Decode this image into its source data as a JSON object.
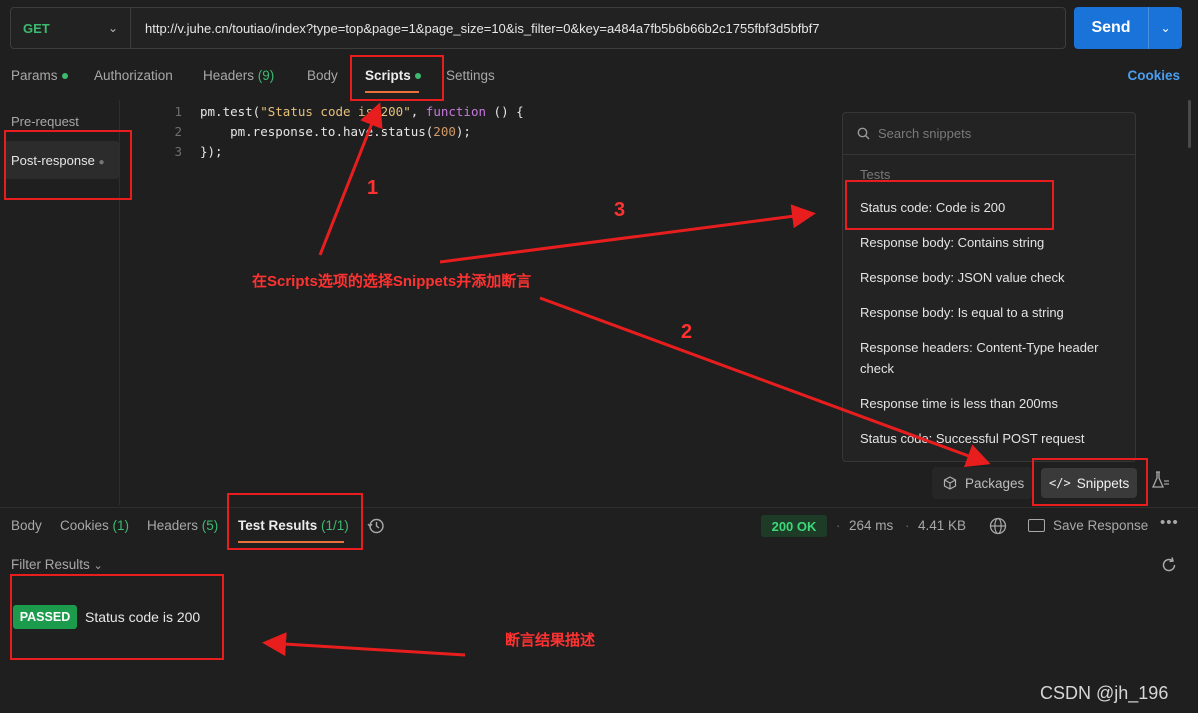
{
  "request": {
    "method": "GET",
    "url": "http://v.juhe.cn/toutiao/index?type=top&page=1&page_size=10&is_filter=0&key=a484a7fb5b6b66b2c1755fbf3d5bfbf7",
    "send_label": "Send"
  },
  "tabs": {
    "params": "Params",
    "authorization": "Authorization",
    "headers": "Headers",
    "headers_count": "(9)",
    "body": "Body",
    "scripts": "Scripts",
    "settings": "Settings",
    "cookies": "Cookies"
  },
  "scripts": {
    "pre_request": "Pre-request",
    "post_response": "Post-response",
    "code": {
      "line1_a": "pm.test(",
      "line1_str": "\"Status code is 200\"",
      "line1_b": ", ",
      "line1_kw": "function",
      "line1_c": " () {",
      "line2_a": "    pm.response.to.have.status(",
      "line2_num": "200",
      "line2_b": ");",
      "line3": "});"
    }
  },
  "snippets": {
    "search_placeholder": "Search snippets",
    "category": "Tests",
    "items": [
      "Status code: Code is 200",
      "Response body: Contains string",
      "Response body: JSON value check",
      "Response body: Is equal to a string",
      "Response headers: Content-Type header check",
      "Response time is less than 200ms",
      "Status code: Successful POST request"
    ],
    "packages_label": "Packages",
    "snippets_label": "Snippets",
    "snippets_icon_text": "</>"
  },
  "response": {
    "tabs": {
      "body": "Body",
      "cookies": "Cookies",
      "cookies_count": "(1)",
      "headers": "Headers",
      "headers_count": "(5)",
      "test_results": "Test Results",
      "test_results_count": "(1/1)"
    },
    "status": "200 OK",
    "time": "264 ms",
    "size": "4.41 KB",
    "save_response": "Save Response",
    "filter_label": "Filter Results",
    "result_badge": "PASSED",
    "result_name": "Status code is 200"
  },
  "annotations": {
    "main_text": "在Scripts选项的选择Snippets并添加断言",
    "result_text": "断言结果描述",
    "step1": "1",
    "step2": "2",
    "step3": "3",
    "accent_color": "#e81e1e"
  },
  "watermark": "CSDN @jh_196"
}
